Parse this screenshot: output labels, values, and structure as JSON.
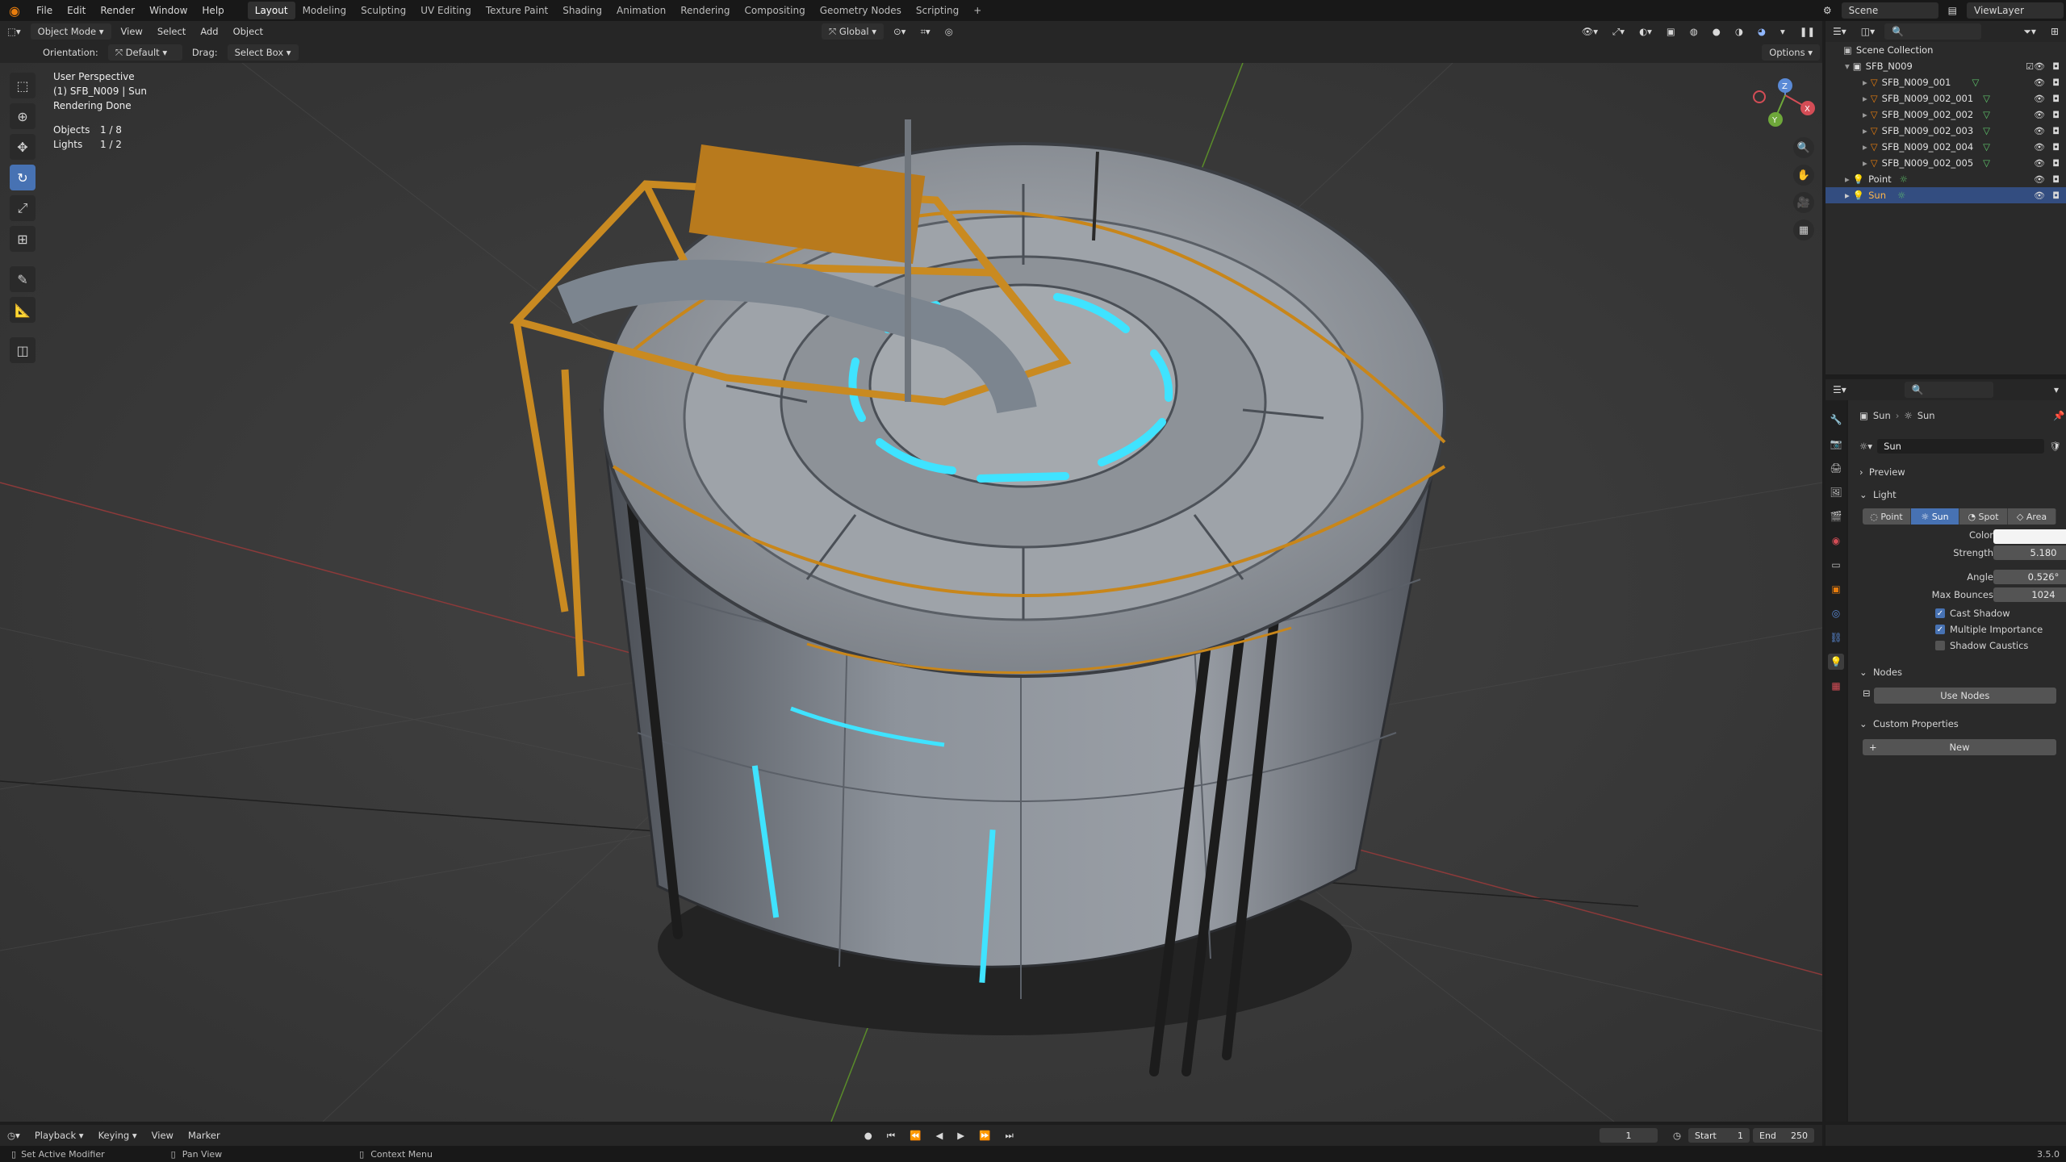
{
  "topbar": {
    "menus": [
      "File",
      "Edit",
      "Render",
      "Window",
      "Help"
    ],
    "workspaces": [
      "Layout",
      "Modeling",
      "Sculpting",
      "UV Editing",
      "Texture Paint",
      "Shading",
      "Animation",
      "Rendering",
      "Compositing",
      "Geometry Nodes",
      "Scripting"
    ],
    "active_workspace": "Layout",
    "scene": "Scene",
    "view_layer": "ViewLayer"
  },
  "viewport_header": {
    "mode": "Object Mode",
    "menus": [
      "View",
      "Select",
      "Add",
      "Object"
    ],
    "transform_orientation": "Global",
    "options": "Options"
  },
  "tool_settings": {
    "orientation_label": "Orientation:",
    "orientation_value": "Default",
    "drag_label": "Drag:",
    "drag_value": "Select Box"
  },
  "viewport_info": {
    "view": "User Perspective",
    "context": "(1) SFB_N009 | Sun",
    "status": "Rendering Done",
    "objects_label": "Objects",
    "objects_value": "1 / 8",
    "lights_label": "Lights",
    "lights_value": "1 / 2"
  },
  "outliner": {
    "collection": "Scene Collection",
    "items": [
      {
        "name": "SFB_N009",
        "indent": 1
      },
      {
        "name": "SFB_N009_001",
        "indent": 2
      },
      {
        "name": "SFB_N009_002_001",
        "indent": 2
      },
      {
        "name": "SFB_N009_002_002",
        "indent": 2
      },
      {
        "name": "SFB_N009_002_003",
        "indent": 2
      },
      {
        "name": "SFB_N009_002_004",
        "indent": 2
      },
      {
        "name": "SFB_N009_002_005",
        "indent": 2
      },
      {
        "name": "Point",
        "indent": 1
      },
      {
        "name": "Sun",
        "indent": 1
      }
    ],
    "selected": "Sun"
  },
  "properties": {
    "breadcrumb_object": "Sun",
    "breadcrumb_data": "Sun",
    "datablock": "Sun",
    "preview_label": "Preview",
    "light_label": "Light",
    "light_types": [
      "Point",
      "Sun",
      "Spot",
      "Area"
    ],
    "active_light_type": "Sun",
    "color_label": "Color",
    "color_value": "#f4f4f4",
    "strength_label": "Strength",
    "strength_value": "5.180",
    "angle_label": "Angle",
    "angle_value": "0.526°",
    "max_bounces_label": "Max Bounces",
    "max_bounces_value": "1024",
    "cast_shadow": "Cast Shadow",
    "multiple_importance": "Multiple Importance",
    "shadow_caustics": "Shadow Caustics",
    "nodes_label": "Nodes",
    "use_nodes": "Use Nodes",
    "custom_props_label": "Custom Properties",
    "new_button": "New"
  },
  "timeline": {
    "menus": [
      "Playback",
      "Keying",
      "View",
      "Marker"
    ],
    "current_frame": "1",
    "start_label": "Start",
    "start_value": "1",
    "end_label": "End",
    "end_value": "250"
  },
  "statusbar": {
    "left": "Set Active Modifier",
    "middle": "Pan View",
    "right": "Context Menu",
    "version": "3.5.0"
  },
  "colors": {
    "accent": "#4772b3",
    "object_orange": "#e87d0d",
    "glow_cyan": "#3fe3ff"
  }
}
